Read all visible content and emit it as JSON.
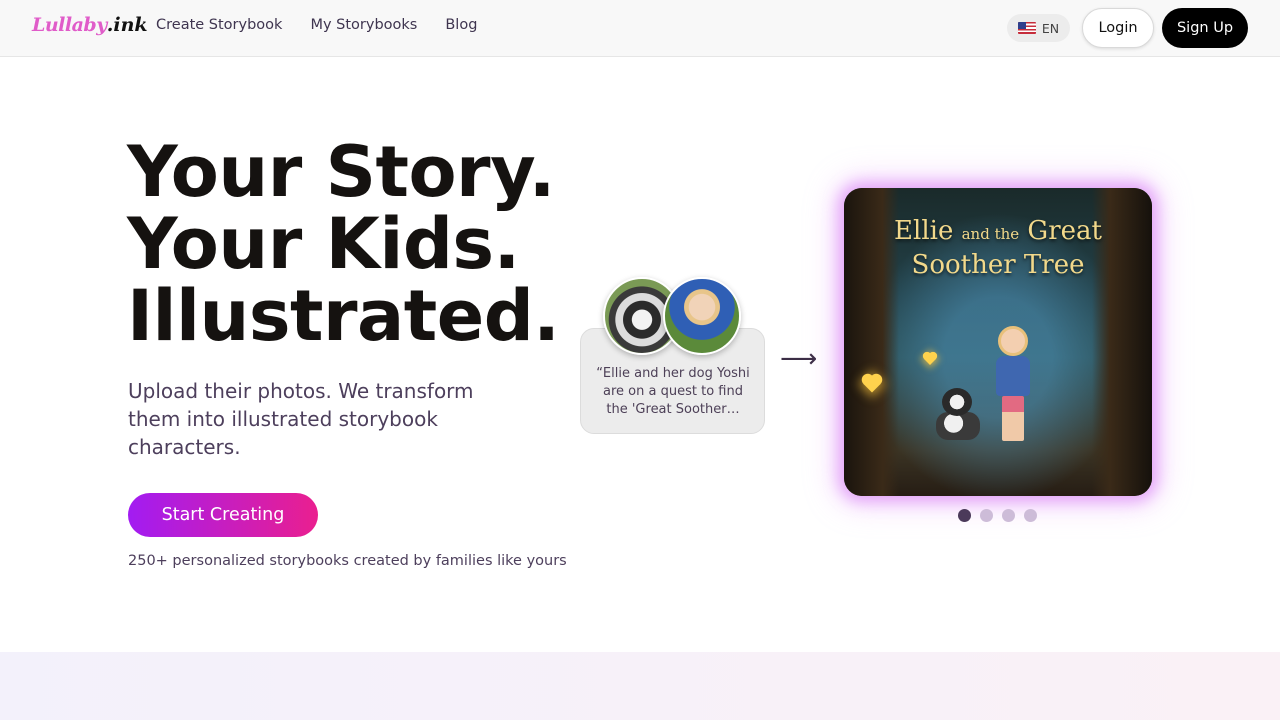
{
  "header": {
    "logo_main": "Lullaby",
    "logo_suffix": ".ink",
    "nav": [
      {
        "label": "Create Storybook"
      },
      {
        "label": "My Storybooks"
      },
      {
        "label": "Blog"
      }
    ],
    "language": "EN",
    "login_label": "Login",
    "signup_label": "Sign Up"
  },
  "hero": {
    "headline": [
      "Your Story.",
      "Your Kids.",
      "Illustrated."
    ],
    "subtitle": "Upload their photos. We transform them into illustrated storybook characters.",
    "cta_label": "Start Creating",
    "social_proof": "250+ personalized storybooks created by families like yours"
  },
  "demo": {
    "quote": "“Ellie and her dog Yoshi are on a quest to find the 'Great Soother…",
    "arrow": "⟶",
    "cover_title_1a": "Ellie",
    "cover_title_1b": "and the",
    "cover_title_1c": "Great",
    "cover_title_2": "Soother Tree",
    "carousel": {
      "count": 4,
      "active_index": 0
    }
  },
  "colors": {
    "accent_gradient_start": "#a21cf2",
    "accent_gradient_end": "#ea1f8f",
    "headline": "#151210",
    "body_text": "#4d3f5c"
  }
}
